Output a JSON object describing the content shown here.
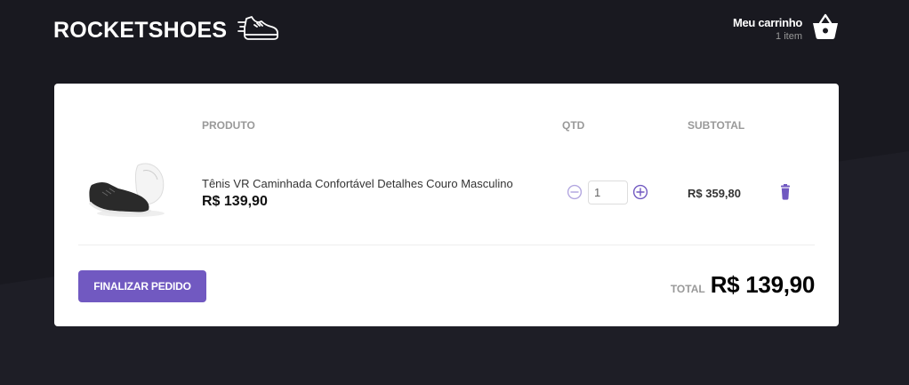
{
  "header": {
    "logo_text": "ROCKETSHOES",
    "cart_title": "Meu carrinho",
    "cart_count": "1 item"
  },
  "table": {
    "columns": [
      "PRODUTO",
      "QTD",
      "SUBTOTAL"
    ]
  },
  "items": [
    {
      "title": "Tênis VR Caminhada Confortável Detalhes Couro Masculino",
      "price": "R$ 139,90",
      "quantity": "1",
      "subtotal": "R$ 359,80"
    }
  ],
  "footer": {
    "checkout_label": "FINALIZAR PEDIDO",
    "total_label": "TOTAL",
    "total_value": "R$ 139,90"
  },
  "colors": {
    "background": "#191920",
    "accent": "#7159c1",
    "card": "#ffffff"
  },
  "icons": {
    "logo": "running-shoe-icon",
    "cart": "shopping-basket-icon",
    "decrement": "minus-circle-icon",
    "increment": "plus-circle-icon",
    "delete": "trash-icon"
  }
}
